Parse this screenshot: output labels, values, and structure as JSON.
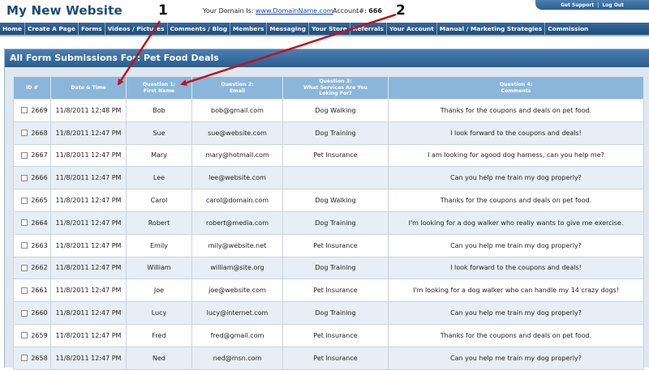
{
  "site": {
    "title": "My New Website",
    "domain_label": "Your Domain Is:",
    "domain_link": "www.DomainName.com",
    "account_label": "Account#:",
    "account_number": "666",
    "get_support": "Get Support",
    "separator": "|",
    "log_out": "Log Out"
  },
  "nav": [
    "Home",
    "Create A Page",
    "Forms",
    "Videos / Pictures",
    "Comments / Blog",
    "Members",
    "Messaging",
    "Your Store",
    "Referrals",
    "Your Account",
    "Manual / Marketing Strategies",
    "Commission"
  ],
  "panel": {
    "title": "All Form Submissions For: Pet Food Deals"
  },
  "table": {
    "headers": [
      {
        "l1": "ID #",
        "l2": "",
        "l3": ""
      },
      {
        "l1": "Date & Time",
        "l2": "",
        "l3": ""
      },
      {
        "l1": "Question 1:",
        "l2": "First Name",
        "l3": ""
      },
      {
        "l1": "Question 2:",
        "l2": "Email",
        "l3": ""
      },
      {
        "l1": "Question 3:",
        "l2": "What Services Are You",
        "l3": "Loking For?"
      },
      {
        "l1": "Question 4:",
        "l2": "Comments",
        "l3": ""
      }
    ],
    "rows": [
      {
        "id": "2669",
        "date": "11/8/2011 12:48 PM",
        "name": "Bob",
        "email": "bob@gmail.com",
        "service": "Dog Walking",
        "comment": "Thanks for the coupons and deals on pet food."
      },
      {
        "id": "2668",
        "date": "11/8/2011 12:47 PM",
        "name": "Sue",
        "email": "sue@website.com",
        "service": "Dog Training",
        "comment": "I look forward to the coupons and deals!"
      },
      {
        "id": "2667",
        "date": "11/8/2011 12:47 PM",
        "name": "Mary",
        "email": "mary@hotmail.com",
        "service": "Pet Insurance",
        "comment": "I am looking for agood dog harness, can you help me?"
      },
      {
        "id": "2666",
        "date": "11/8/2011 12:47 PM",
        "name": "Lee",
        "email": "lee@website.com",
        "service": "",
        "comment": "Can you help me train my dog properly?"
      },
      {
        "id": "2665",
        "date": "11/8/2011 12:47 PM",
        "name": "Carol",
        "email": "carol@domain.com",
        "service": "Dog Walking",
        "comment": "Thanks for the coupons and deals on pet food."
      },
      {
        "id": "2664",
        "date": "11/8/2011 12:47 PM",
        "name": "Robert",
        "email": "robert@media.com",
        "service": "Dog Training",
        "comment": "I'm looking for a dog walker who really wants to give me exercise."
      },
      {
        "id": "2663",
        "date": "11/8/2011 12:47 PM",
        "name": "Emily",
        "email": "mily@website.net",
        "service": "Pet Insurance",
        "comment": "Can you help me train my dog properly?"
      },
      {
        "id": "2662",
        "date": "11/8/2011 12:47 PM",
        "name": "William",
        "email": "william@site.org",
        "service": "Dog Training",
        "comment": "I look forward to the coupons and deals!"
      },
      {
        "id": "2661",
        "date": "11/8/2011 12:47 PM",
        "name": "Joe",
        "email": "joe@website.com",
        "service": "Pet Insurance",
        "comment": "I'm looking for a dog walker who can handle my 14 crazy dogs!"
      },
      {
        "id": "2660",
        "date": "11/8/2011 12:47 PM",
        "name": "Lucy",
        "email": "lucy@internet.com",
        "service": "Dog Training",
        "comment": "Can you help me train my dog properly?"
      },
      {
        "id": "2659",
        "date": "11/8/2011 12:47 PM",
        "name": "Fred",
        "email": "fred@gmail.com",
        "service": "Pet Insurance",
        "comment": "Thanks for the coupons and deals on pet food."
      },
      {
        "id": "2658",
        "date": "11/8/2011 12:47 PM",
        "name": "Ned",
        "email": "ned@msn.com",
        "service": "Pet Insurance",
        "comment": "Can you help me train my dog properly?"
      }
    ]
  },
  "annotations": [
    {
      "number": "1"
    },
    {
      "number": "2"
    }
  ],
  "colors": {
    "brand": "#1c4a7a",
    "nav": "#2b5c8e",
    "header_cell": "#8bb6da",
    "arrow": "#c0131a"
  }
}
